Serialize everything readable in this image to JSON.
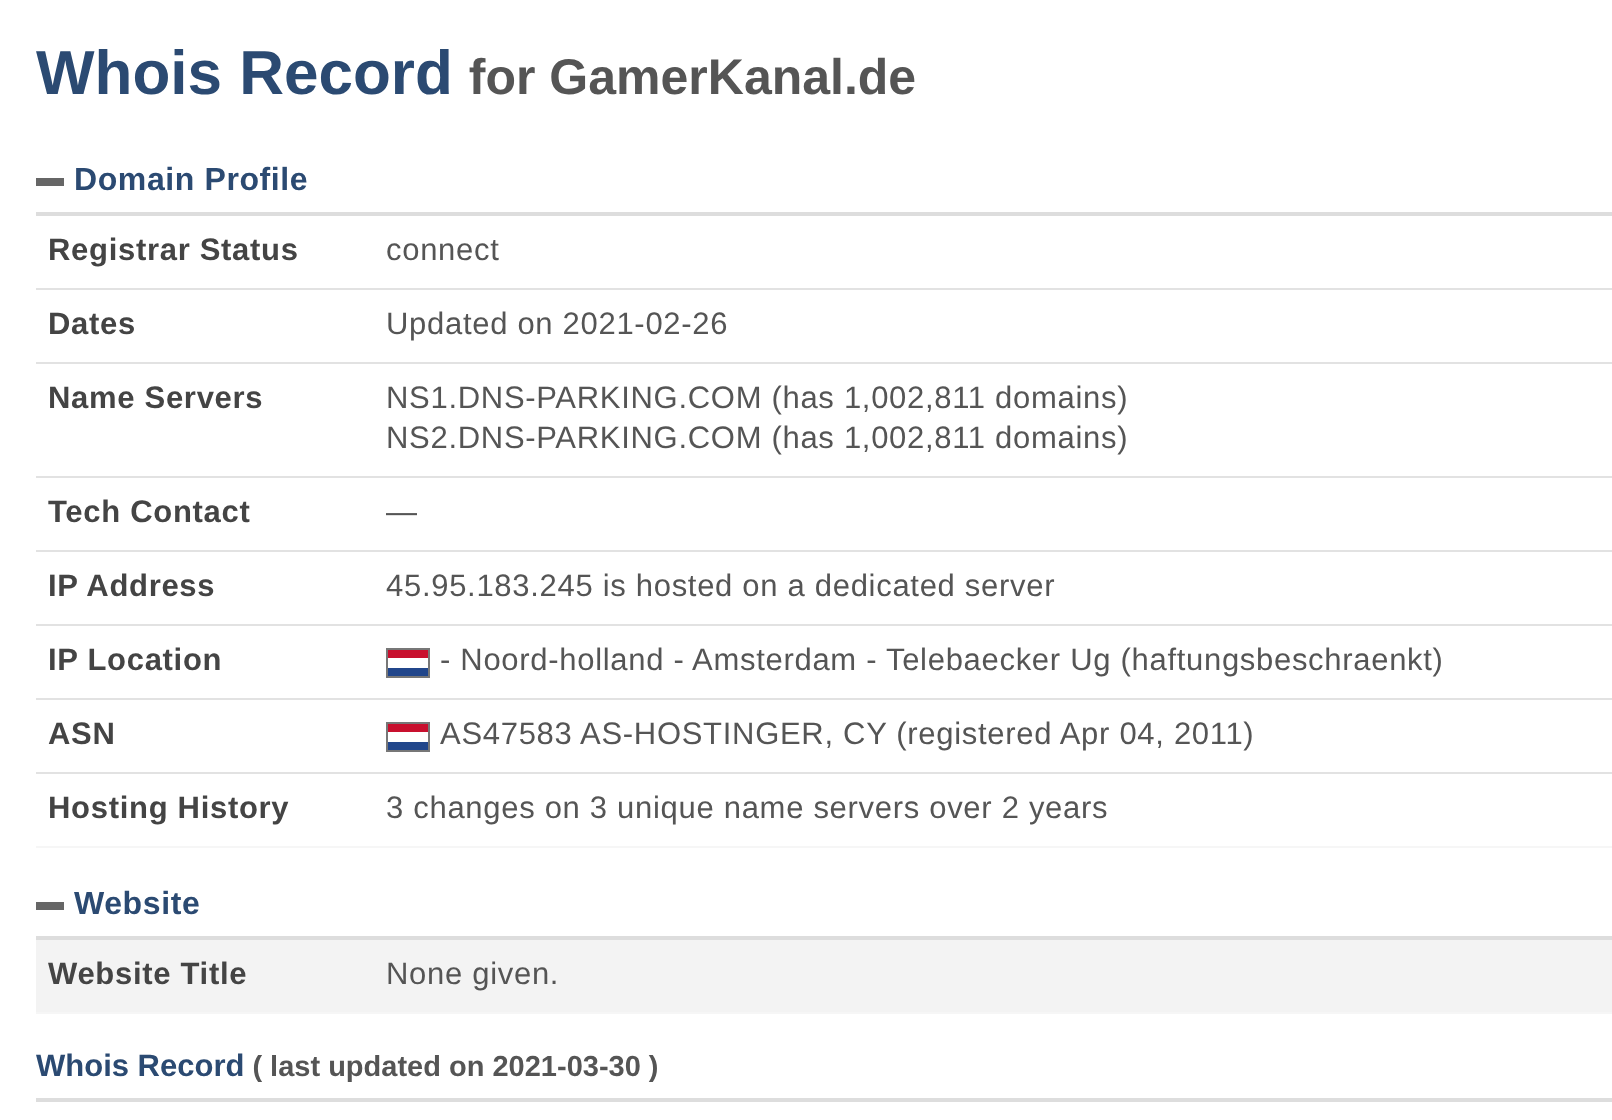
{
  "heading": {
    "title": "Whois Record",
    "subtitle": "for GamerKanal.de"
  },
  "sections": [
    {
      "title": "Domain Profile",
      "expanded": true,
      "rows": [
        {
          "label": "Registrar Status",
          "lines": [
            "connect"
          ],
          "flag": false,
          "highlighted": false
        },
        {
          "label": "Dates",
          "lines": [
            "Updated on 2021-02-26"
          ],
          "flag": false,
          "highlighted": false
        },
        {
          "label": "Name Servers",
          "lines": [
            "NS1.DNS-PARKING.COM (has 1,002,811 domains)",
            "NS2.DNS-PARKING.COM (has 1,002,811 domains)"
          ],
          "flag": false,
          "highlighted": false
        },
        {
          "label": "Tech Contact",
          "lines": [
            "—"
          ],
          "flag": false,
          "highlighted": false
        },
        {
          "label": "IP Address",
          "lines": [
            "45.95.183.245 is hosted on a dedicated server"
          ],
          "flag": false,
          "highlighted": false
        },
        {
          "label": "IP Location",
          "lines": [
            "- Noord-holland - Amsterdam - Telebaecker Ug (haftungsbeschraenkt)"
          ],
          "flag": true,
          "highlighted": false
        },
        {
          "label": "ASN",
          "lines": [
            "AS47583 AS-HOSTINGER, CY (registered Apr 04, 2011)"
          ],
          "flag": true,
          "highlighted": false
        },
        {
          "label": "Hosting History",
          "lines": [
            "3 changes on 3 unique name servers over 2 years"
          ],
          "flag": false,
          "highlighted": false
        }
      ]
    },
    {
      "title": "Website",
      "expanded": true,
      "rows": [
        {
          "label": "Website Title",
          "lines": [
            "None given."
          ],
          "flag": false,
          "highlighted": true
        }
      ]
    }
  ],
  "footer": {
    "link": "Whois Record",
    "note": "( last updated on 2021-03-30 )"
  }
}
